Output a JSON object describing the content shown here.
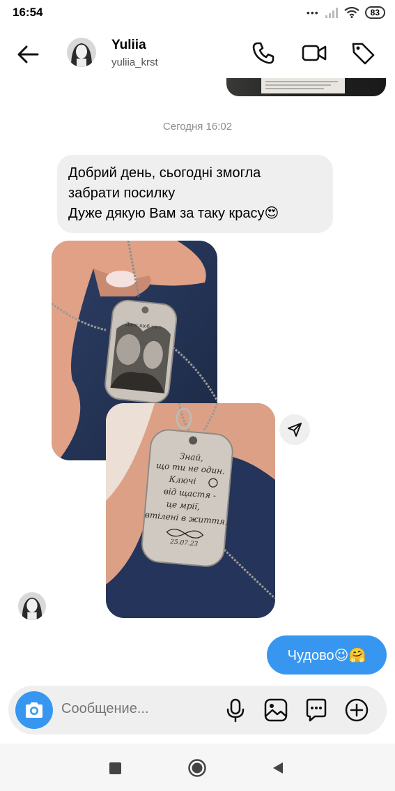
{
  "status_bar": {
    "time": "16:54",
    "battery": "83"
  },
  "header": {
    "name": "Yuliia",
    "username": "yuliia_krst"
  },
  "chat": {
    "timestamp": "Сегодня 16:02",
    "incoming_lines": [
      "Добрий день, сьогодні змогла",
      "забрати посилку",
      "Дуже дякую Вам за таку красу😍"
    ],
    "photo1_tag_text": "Двоє щоб ти с",
    "photo2_engraving": [
      "Знай,",
      "що ти не один.",
      "Ключі",
      "від щастя -",
      "це мрії,",
      "втілені в життя.",
      "25.07.23"
    ],
    "outgoing": "Чудово😉🤗"
  },
  "composer": {
    "placeholder": "Сообщение..."
  },
  "colors": {
    "accent": "#3797f0",
    "bubble_in": "#efefef",
    "timestamp": "#8e8e8e"
  },
  "icons": [
    "back-arrow-icon",
    "phone-icon",
    "video-icon",
    "tag-icon",
    "share-icon",
    "camera-icon",
    "mic-icon",
    "image-icon",
    "sticker-icon",
    "plus-icon",
    "nav-square-icon",
    "nav-home-icon",
    "nav-back-icon"
  ]
}
